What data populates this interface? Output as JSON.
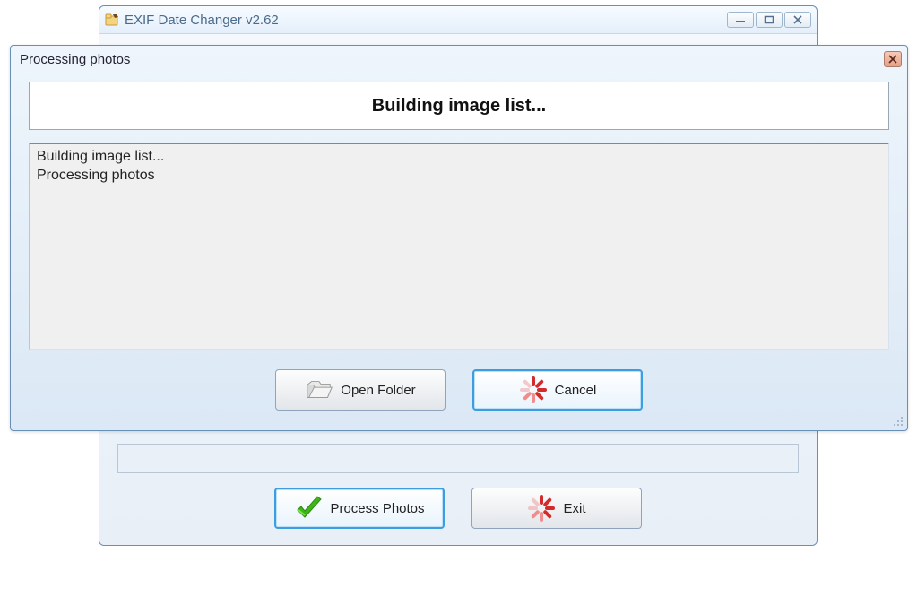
{
  "parent_window": {
    "title": "EXIF Date Changer v2.62",
    "buttons": {
      "process_photos_label": "Process Photos",
      "exit_label": "Exit"
    }
  },
  "dialog": {
    "title": "Processing photos",
    "status_text": "Building image list...",
    "log_lines": "Building image list...\nProcessing photos",
    "buttons": {
      "open_folder_label": "Open Folder",
      "cancel_label": "Cancel"
    }
  },
  "icons": {
    "app_icon": "folder-wrench-icon",
    "minimize": "minimize-icon",
    "maximize": "maximize-icon",
    "close": "close-icon",
    "folder": "folder-open-icon",
    "spinner": "loading-spinner-icon",
    "check": "checkmark-icon"
  },
  "colors": {
    "spinner_red": "#d42a2a",
    "spinner_red_light": "#f28c8c",
    "check_green": "#3fb618",
    "check_green_dark": "#2a8a10"
  }
}
